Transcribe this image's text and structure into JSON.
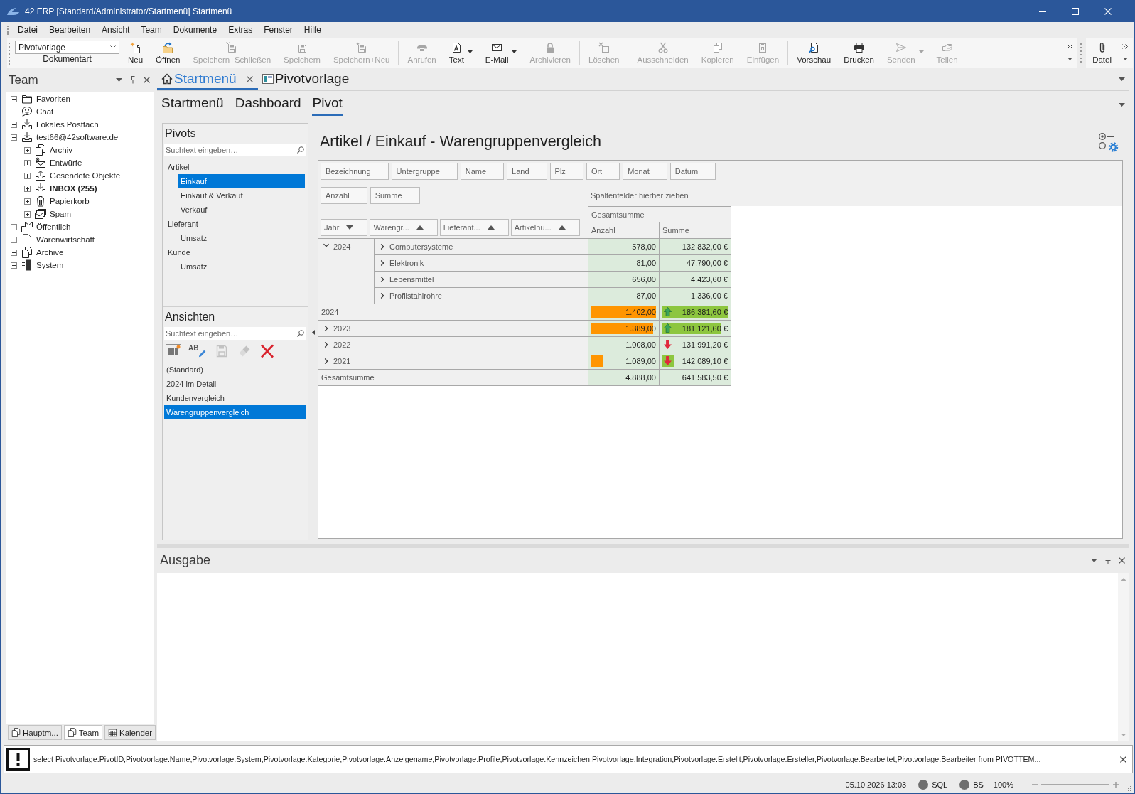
{
  "window": {
    "title": "42 ERP [Standard/Administrator/Startmenü] Startmenü"
  },
  "menu": [
    "Datei",
    "Bearbeiten",
    "Ansicht",
    "Team",
    "Dokumente",
    "Extras",
    "Fenster",
    "Hilfe"
  ],
  "toolbar": {
    "document_type": {
      "value": "Pivotvorlage",
      "label": "Dokumentart"
    },
    "groups": [
      [
        {
          "label": "Neu",
          "kind": "new",
          "disabled": false,
          "dropdown": false
        },
        {
          "label": "Öffnen",
          "kind": "open",
          "disabled": false,
          "dropdown": false
        },
        {
          "label": "Speichern+Schließen",
          "kind": "save-close",
          "disabled": true,
          "dropdown": false
        },
        {
          "label": "Speichern",
          "kind": "save",
          "disabled": true,
          "dropdown": false
        },
        {
          "label": "Speichern+Neu",
          "kind": "save-new",
          "disabled": true,
          "dropdown": false
        }
      ],
      [
        {
          "label": "Anrufen",
          "kind": "phone",
          "disabled": true,
          "dropdown": false
        },
        {
          "label": "Text",
          "kind": "text",
          "disabled": false,
          "dropdown": true
        },
        {
          "label": "E-Mail",
          "kind": "mail",
          "disabled": false,
          "dropdown": true
        },
        {
          "label": "Archivieren",
          "kind": "lock",
          "disabled": true,
          "dropdown": false
        }
      ],
      [
        {
          "label": "Löschen",
          "kind": "delete",
          "disabled": true,
          "dropdown": false
        }
      ],
      [
        {
          "label": "Ausschneiden",
          "kind": "cut",
          "disabled": true,
          "dropdown": false
        },
        {
          "label": "Kopieren",
          "kind": "copy",
          "disabled": true,
          "dropdown": false
        },
        {
          "label": "Einfügen",
          "kind": "paste",
          "disabled": true,
          "dropdown": false
        }
      ],
      [
        {
          "label": "Vorschau",
          "kind": "preview",
          "disabled": false,
          "dropdown": false
        },
        {
          "label": "Drucken",
          "kind": "print",
          "disabled": false,
          "dropdown": false
        },
        {
          "label": "Senden",
          "kind": "send",
          "disabled": true,
          "dropdown": true
        },
        {
          "label": "Teilen",
          "kind": "share",
          "disabled": true,
          "dropdown": false
        }
      ]
    ],
    "file_group": [
      {
        "label": "Datei",
        "kind": "attach",
        "disabled": false,
        "dropdown": false
      }
    ]
  },
  "team_panel": {
    "title": "Team",
    "tree": [
      {
        "label": "Favoriten",
        "kind": "folder",
        "expanded": false,
        "bold": false
      },
      {
        "label": "Chat",
        "kind": "chat",
        "bold": false
      },
      {
        "label": "Lokales Postfach",
        "kind": "inbox",
        "expanded": false,
        "bold": false
      },
      {
        "label": "test66@42software.de",
        "kind": "inbox",
        "expanded": true,
        "bold": false,
        "children": [
          {
            "label": "Archiv",
            "kind": "archive",
            "expanded": false,
            "bold": false
          },
          {
            "label": "Entwürfe",
            "kind": "drafts",
            "expanded": false,
            "bold": false
          },
          {
            "label": "Gesendete Objekte",
            "kind": "outbox",
            "expanded": false,
            "bold": false
          },
          {
            "label": "INBOX (255)",
            "kind": "inbox",
            "expanded": false,
            "bold": true
          },
          {
            "label": "Papierkorb",
            "kind": "trash",
            "expanded": false,
            "bold": false
          },
          {
            "label": "Spam",
            "kind": "spam",
            "expanded": false,
            "bold": false
          }
        ]
      },
      {
        "label": "Öffentlich",
        "kind": "public",
        "expanded": false,
        "bold": false
      },
      {
        "label": "Warenwirtschaft",
        "kind": "document",
        "expanded": false,
        "bold": false
      },
      {
        "label": "Archive",
        "kind": "archive",
        "expanded": false,
        "bold": false
      },
      {
        "label": "System",
        "kind": "server",
        "expanded": false,
        "bold": false
      }
    ],
    "tabs": [
      {
        "label": "Hauptm...",
        "kind": "pages",
        "selected": false
      },
      {
        "label": "Team",
        "kind": "pages",
        "selected": true
      },
      {
        "label": "Kalender",
        "kind": "calendar",
        "selected": false
      }
    ]
  },
  "document_tabs": [
    {
      "label": "Startmenü",
      "kind": "home",
      "selected": true,
      "closable": true
    },
    {
      "label": "Pivotvorlage",
      "kind": "form",
      "selected": false,
      "closable": false
    }
  ],
  "view_tabs": [
    {
      "label": "Startmenü",
      "selected": false
    },
    {
      "label": "Dashboard",
      "selected": false
    },
    {
      "label": "Pivot",
      "selected": true
    }
  ],
  "pivots": {
    "title": "Pivots",
    "search": {
      "placeholder": "Suchtext eingeben…"
    },
    "items": [
      {
        "label": "Artikel",
        "selected": false,
        "children": [
          {
            "label": "Einkauf",
            "selected": true
          },
          {
            "label": "Einkauf & Verkauf",
            "selected": false
          },
          {
            "label": "Verkauf",
            "selected": false
          }
        ]
      },
      {
        "label": "Lieferant",
        "selected": false,
        "children": [
          {
            "label": "Umsatz",
            "selected": false
          }
        ]
      },
      {
        "label": "Kunde",
        "selected": false,
        "children": [
          {
            "label": "Umsatz",
            "selected": false
          }
        ]
      }
    ]
  },
  "views": {
    "title": "Ansichten",
    "search": {
      "placeholder": "Suchtext eingeben…"
    },
    "tools": [
      {
        "kind": "new",
        "disabled": false
      },
      {
        "kind": "rename",
        "label": "AB",
        "disabled": false
      },
      {
        "kind": "save",
        "disabled": true
      },
      {
        "kind": "clear",
        "disabled": true
      },
      {
        "kind": "delete",
        "disabled": false
      }
    ],
    "items": [
      {
        "label": "(Standard)",
        "selected": false
      },
      {
        "label": "2024 im Detail",
        "selected": false
      },
      {
        "label": "Kundenvergleich",
        "selected": false
      },
      {
        "label": "Warengruppenvergleich",
        "selected": true
      }
    ]
  },
  "pivot": {
    "title": "Artikel / Einkauf - Warengruppenvergleich",
    "filter_fields": [
      "Bezeichnung",
      "Untergruppe",
      "Name",
      "Land",
      "Plz",
      "Ort",
      "Monat",
      "Datum"
    ],
    "data_fields": [
      "Anzahl",
      "Summe"
    ],
    "column_hint": "Spaltenfelder hierher ziehen",
    "row_fields": [
      {
        "label": "Jahr",
        "descending": true
      },
      {
        "label": "Warengr...",
        "descending": false
      },
      {
        "label": "Lieferant...",
        "descending": false
      },
      {
        "label": "Artikelnu...",
        "descending": false
      }
    ],
    "column_total": "Gesamtsumme",
    "value_columns": [
      {
        "label": "Anzahl",
        "color": "#ff9500"
      },
      {
        "label": "Summe",
        "color": "#8dc63f"
      }
    ],
    "rows": [
      {
        "kind": "year",
        "label": "2024",
        "expanded": true,
        "children": [
          {
            "label": "Computersysteme",
            "expanded": false,
            "values": [
              {
                "text": "578,00"
              },
              {
                "text": "132.832,00 €"
              }
            ]
          },
          {
            "label": "Elektronik",
            "expanded": false,
            "values": [
              {
                "text": "81,00"
              },
              {
                "text": "47.790,00 €"
              }
            ]
          },
          {
            "label": "Lebensmittel",
            "expanded": false,
            "values": [
              {
                "text": "656,00"
              },
              {
                "text": "4.423,60 €"
              }
            ]
          },
          {
            "label": "Profilstahlrohre",
            "expanded": false,
            "values": [
              {
                "text": "87,00"
              },
              {
                "text": "1.336,00 €"
              }
            ]
          }
        ]
      },
      {
        "kind": "total",
        "label": "2024",
        "values": [
          {
            "text": "1.402,00",
            "level": 1
          },
          {
            "text": "186.381,60 €",
            "level": 1,
            "rising": true
          }
        ]
      },
      {
        "kind": "year",
        "label": "2023",
        "expanded": false,
        "values": [
          {
            "text": "1.389,00",
            "level": 0.96
          },
          {
            "text": "181.121,60 €",
            "level": 0.9,
            "rising": true
          }
        ]
      },
      {
        "kind": "year",
        "label": "2022",
        "expanded": false,
        "values": [
          {
            "text": "1.008,00"
          },
          {
            "text": "131.991,20 €",
            "rising": false
          }
        ]
      },
      {
        "kind": "year",
        "label": "2021",
        "expanded": false,
        "values": [
          {
            "text": "1.089,00",
            "level": 0.18
          },
          {
            "text": "142.089,10 €",
            "level": 0.17,
            "rising": false
          }
        ]
      },
      {
        "kind": "grand_total",
        "label": "Gesamtsumme",
        "values": [
          {
            "text": "4.888,00"
          },
          {
            "text": "641.583,50 €"
          }
        ]
      }
    ]
  },
  "output_panel": {
    "title": "Ausgabe"
  },
  "message": {
    "text": "select Pivotvorlage.PivotID,Pivotvorlage.Name,Pivotvorlage.System,Pivotvorlage.Kategorie,Pivotvorlage.Anzeigename,Pivotvorlage.Profile,Pivotvorlage.Kennzeichen,Pivotvorlage.Integration,Pivotvorlage.Erstellt,Pivotvorlage.Ersteller,Pivotvorlage.Bearbeitet,Pivotvorlage.Bearbeiter from PIVOTTEM..."
  },
  "status_bar": {
    "datetime": "05.10.2026 13:03",
    "indicators": [
      {
        "label": "SQL"
      },
      {
        "label": "BS"
      }
    ],
    "zoom": {
      "label": "100%"
    }
  }
}
